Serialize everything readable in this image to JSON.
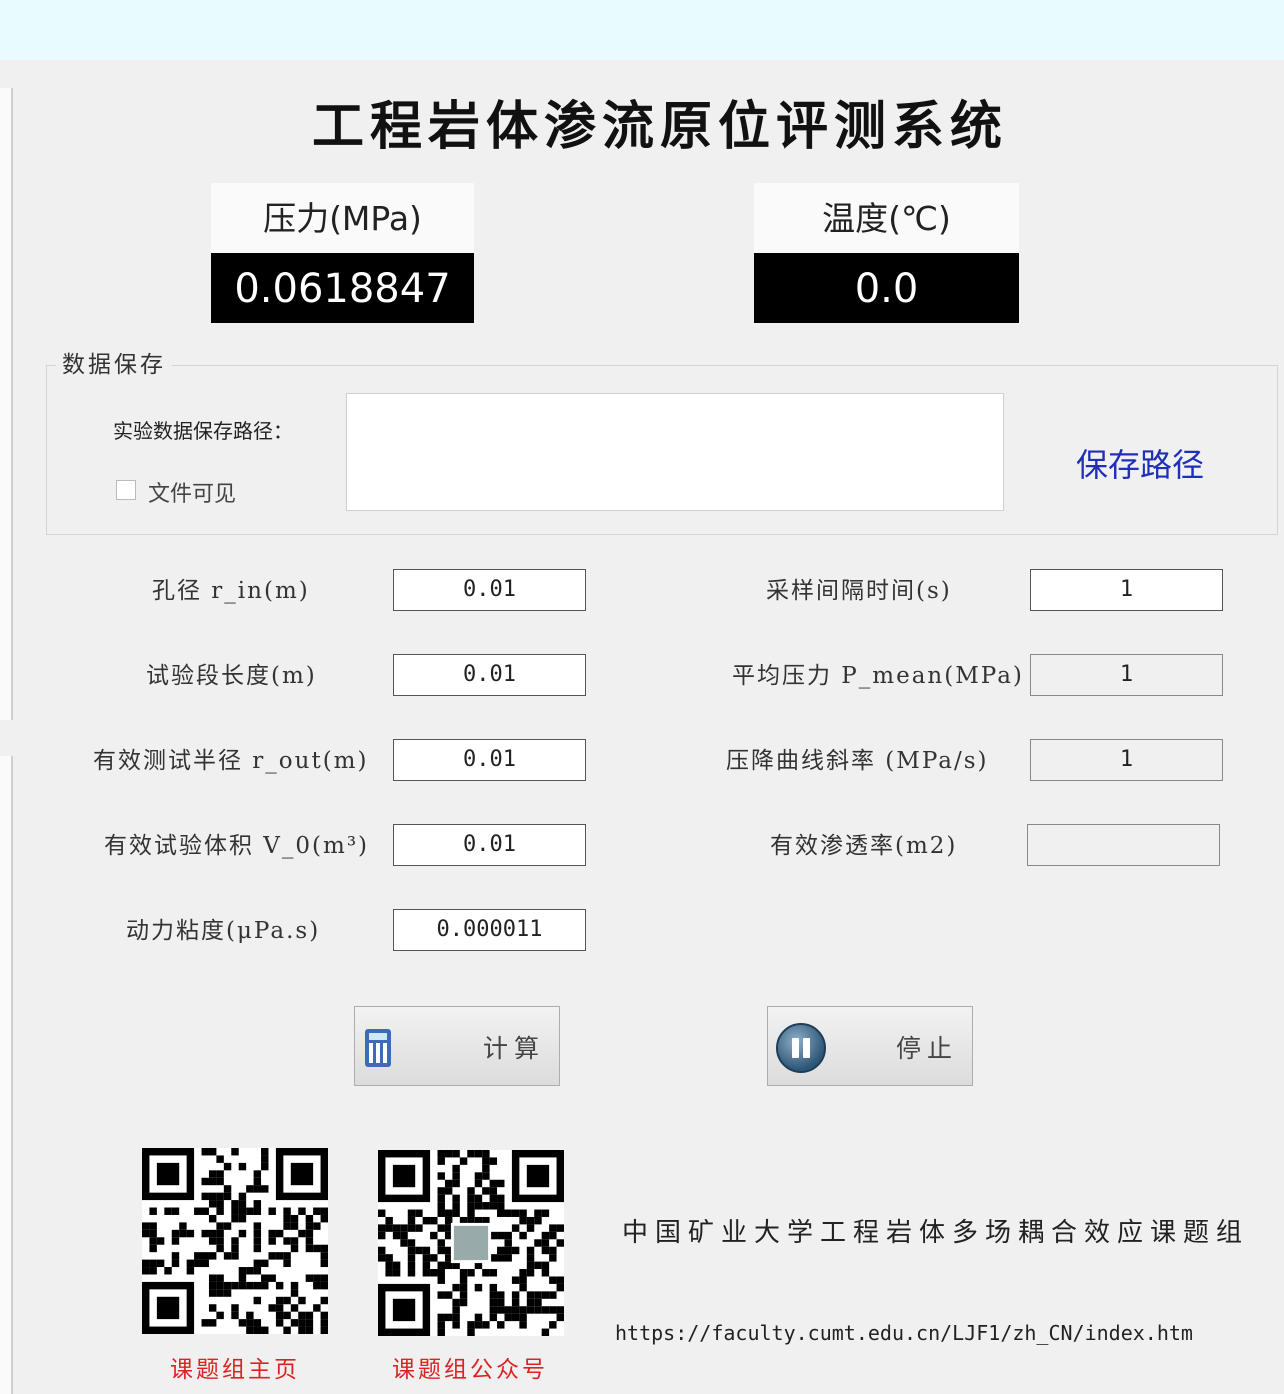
{
  "title": "工程岩体渗流原位评测系统",
  "gauges": {
    "pressure": {
      "label": "压力(MPa)",
      "value": "0.0618847"
    },
    "temperature": {
      "label": "温度(℃)",
      "value": "0.0"
    }
  },
  "data_save": {
    "legend": "数据保存",
    "path_label": "实验数据保存路径：",
    "path_value": "",
    "file_visible_label": "文件可见",
    "file_visible_checked": false,
    "save_path_link": "保存路径"
  },
  "fields_left": [
    {
      "label": "孔径 r_in(m)",
      "value": "0.01"
    },
    {
      "label": "试验段长度(m)",
      "value": "0.01"
    },
    {
      "label": "有效测试半径 r_out(m)",
      "value": "0.01"
    },
    {
      "label": "有效试验体积 V_0(m³)",
      "value": "0.01"
    },
    {
      "label": "动力粘度(μPa.s)",
      "value": "0.000011"
    }
  ],
  "fields_right": [
    {
      "label": "采样间隔时间(s)",
      "value": "1"
    },
    {
      "label": "平均压力 P_mean(MPa)",
      "value": "1"
    },
    {
      "label": "压降曲线斜率 (MPa/s)",
      "value": "1"
    },
    {
      "label": "有效渗透率(m2)",
      "value": ""
    }
  ],
  "buttons": {
    "calculate": "计算",
    "stop": "停止"
  },
  "footer": {
    "qr_homepage_caption": "课题组主页",
    "qr_wechat_caption": "课题组公众号",
    "organization": "中国矿业大学工程岩体多场耦合效应课题组",
    "url": "https://faculty.cumt.edu.cn/LJF1/zh_CN/index.htm"
  }
}
